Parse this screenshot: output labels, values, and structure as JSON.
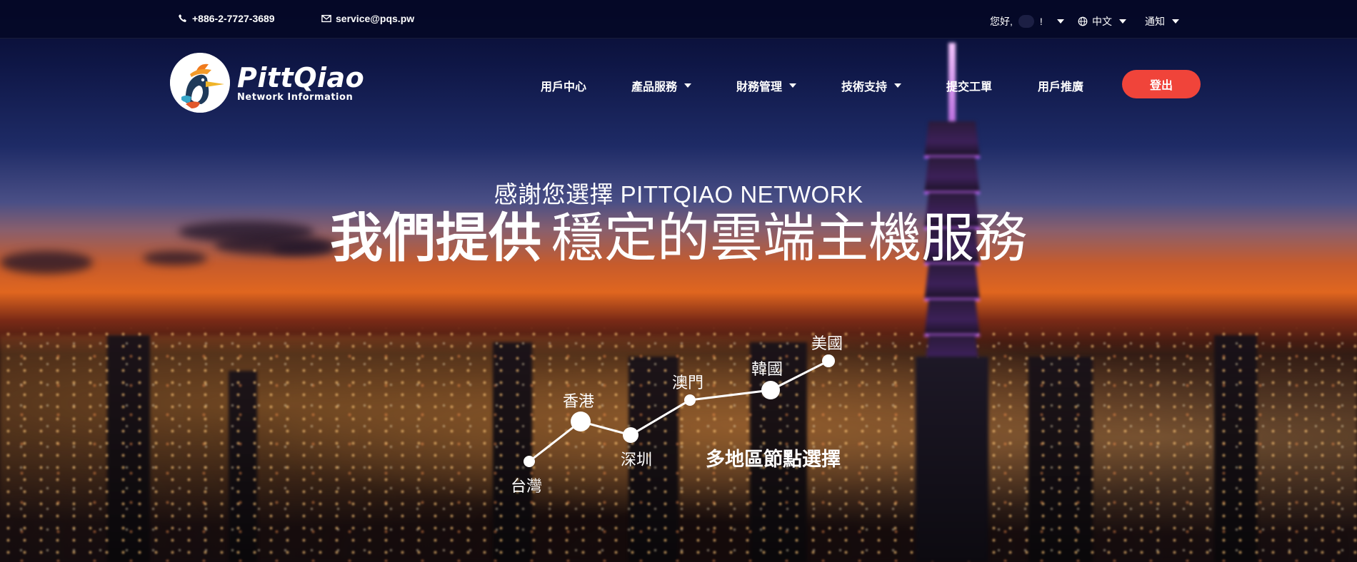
{
  "topbar": {
    "phone": "+886-2-7727-3689",
    "email": "service@pqs.pw",
    "greeting_prefix": "您好,",
    "greeting_suffix": "!",
    "language": "中文",
    "notifications": "通知"
  },
  "brand": {
    "name": "PittQiao",
    "tagline": "Network Information"
  },
  "nav": {
    "items": [
      {
        "label": "用戶中心",
        "dropdown": false
      },
      {
        "label": "產品服務",
        "dropdown": true
      },
      {
        "label": "財務管理",
        "dropdown": true
      },
      {
        "label": "技術支持",
        "dropdown": true
      },
      {
        "label": "提交工單",
        "dropdown": false
      },
      {
        "label": "用戶推廣",
        "dropdown": false
      }
    ],
    "logout": "登出"
  },
  "hero": {
    "subtitle": "感謝您選擇 PITTQIAO NETWORK",
    "title_bold": "我們提供",
    "title_light": "穩定的雲端主機服務"
  },
  "map": {
    "nodes": [
      "台灣",
      "香港",
      "深圳",
      "澳門",
      "韓國",
      "美國"
    ],
    "caption": "多地區節點選擇"
  },
  "colors": {
    "accent": "#f0443a",
    "topbar_bg": "#050826"
  }
}
